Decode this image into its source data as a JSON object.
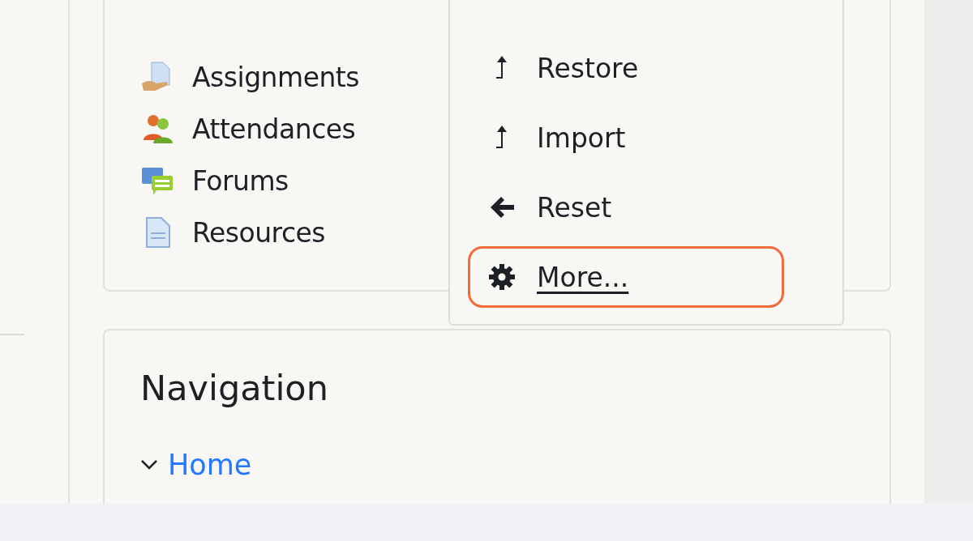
{
  "activities": {
    "items": [
      {
        "label": "Assignments",
        "kind": "assignment"
      },
      {
        "label": "Attendances",
        "kind": "attendance"
      },
      {
        "label": "Forums",
        "kind": "forum"
      },
      {
        "label": "Resources",
        "kind": "resource"
      }
    ]
  },
  "admin_menu": {
    "items": [
      {
        "label": "Restore",
        "kind": "upload",
        "focused": false
      },
      {
        "label": "Import",
        "kind": "upload",
        "focused": false
      },
      {
        "label": "Reset",
        "kind": "back",
        "focused": false
      },
      {
        "label": "More...",
        "kind": "gear",
        "focused": true
      }
    ]
  },
  "navigation": {
    "title": "Navigation",
    "items": [
      {
        "label": "Home",
        "expanded": true
      }
    ]
  }
}
